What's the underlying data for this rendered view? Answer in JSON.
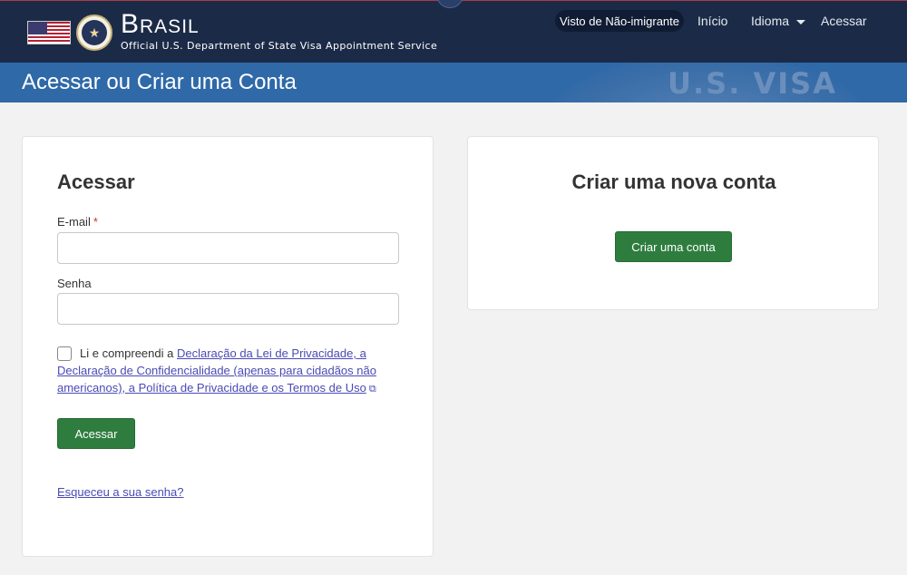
{
  "header": {
    "brand_title": "Brasil",
    "brand_subtitle": "Official U.S. Department of State Visa Appointment Service",
    "nav": {
      "visa_type": "Visto de Não-imigrante",
      "home": "Início",
      "language": "Idioma",
      "login": "Acessar"
    }
  },
  "banner": {
    "title": "Acessar ou Criar uma Conta",
    "stamp_text": "U.S. VISA"
  },
  "login": {
    "heading": "Acessar",
    "email_label": "E-mail",
    "email_required": "*",
    "email_value": "",
    "password_label": "Senha",
    "password_value": "",
    "terms_prefix": "Li e compreendi a ",
    "terms_link": "Declaração da Lei de Privacidade, a Declaração de Confidencialidade (apenas para cidadãos não americanos), a Política de Privacidade e os Termos de Uso",
    "submit_label": "Acessar",
    "forgot_link": "Esqueceu a sua senha?"
  },
  "create": {
    "heading": "Criar uma nova conta",
    "button_label": "Criar uma conta"
  },
  "colors": {
    "header_bg": "#1b2b47",
    "banner_bg": "#2f69a8",
    "button_green": "#2e7d3e",
    "link": "#4a4ab5"
  }
}
